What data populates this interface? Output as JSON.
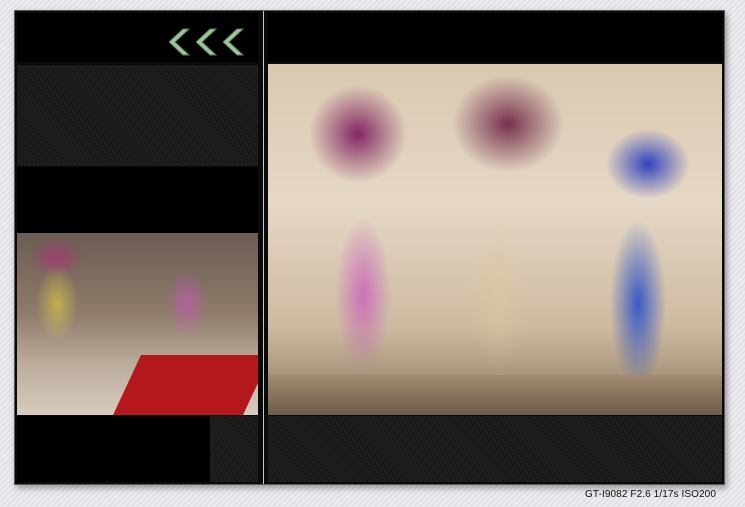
{
  "exif_info": "GT-I9082 F2.6 1/17s ISO200",
  "nav": {
    "arrows_icon": "triple-left-chevron-icon",
    "arrow_color": "#9ec89a"
  },
  "photos": {
    "left": {
      "subject": "small-photo"
    },
    "right": {
      "subject": "large-photo"
    }
  },
  "colors": {
    "frame_bg": "#0a0a0a",
    "page_bg": "#e4e4ea",
    "carpet": "#b4181c"
  }
}
